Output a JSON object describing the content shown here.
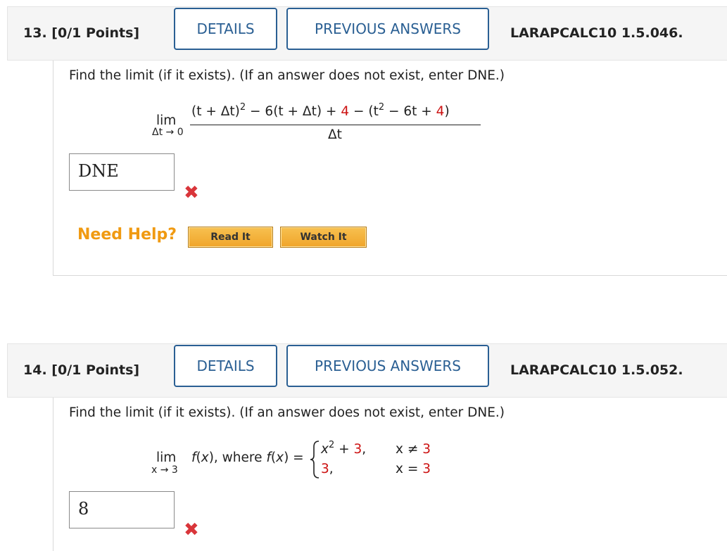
{
  "questions": [
    {
      "number": "13.",
      "points": "[0/1 Points]",
      "details_label": "DETAILS",
      "previous_label": "PREVIOUS ANSWERS",
      "code": "LARAPCALC10 1.5.046.",
      "prompt": "Find the limit (if it exists). (If an answer does not exist, enter DNE.)",
      "lim": "lim",
      "lim_sub": "Δt → 0",
      "numerator": {
        "p1": "(t + Δt)",
        "exp": "2",
        "p2": " − 6(t + Δt) + ",
        "c1": "4",
        "p3": " − (t",
        "exp2": "2",
        "p4": " − 6t + ",
        "c2": "4",
        "p5": ")"
      },
      "denominator": "Δt",
      "answer": "DNE",
      "need_help": "Need Help?",
      "read_label": "Read It",
      "watch_label": "Watch It"
    },
    {
      "number": "14.",
      "points": "[0/1 Points]",
      "details_label": "DETAILS",
      "previous_label": "PREVIOUS ANSWERS",
      "code": "LARAPCALC10 1.5.052.",
      "prompt": "Find the limit (if it exists). (If an answer does not exist, enter DNE.)",
      "lim": "lim",
      "lim_sub": "x → 3",
      "lim_expr": "f(x), where f(x) =",
      "case1": {
        "expr": "x",
        "exp": "2",
        "plus": " + ",
        "const": "3",
        "comma": ",",
        "cond": "x ≠ ",
        "cond_val": "3"
      },
      "case2": {
        "expr": "3",
        "comma": ",",
        "cond": "x = ",
        "cond_val": "3"
      },
      "answer": "8"
    }
  ],
  "colors": {
    "accent_blue": "#2a5f93",
    "need_help_orange": "#f09a12",
    "error_red": "#d9353a",
    "math_red": "#cc1111"
  },
  "icons": {
    "wrong": "x-mark-icon"
  }
}
